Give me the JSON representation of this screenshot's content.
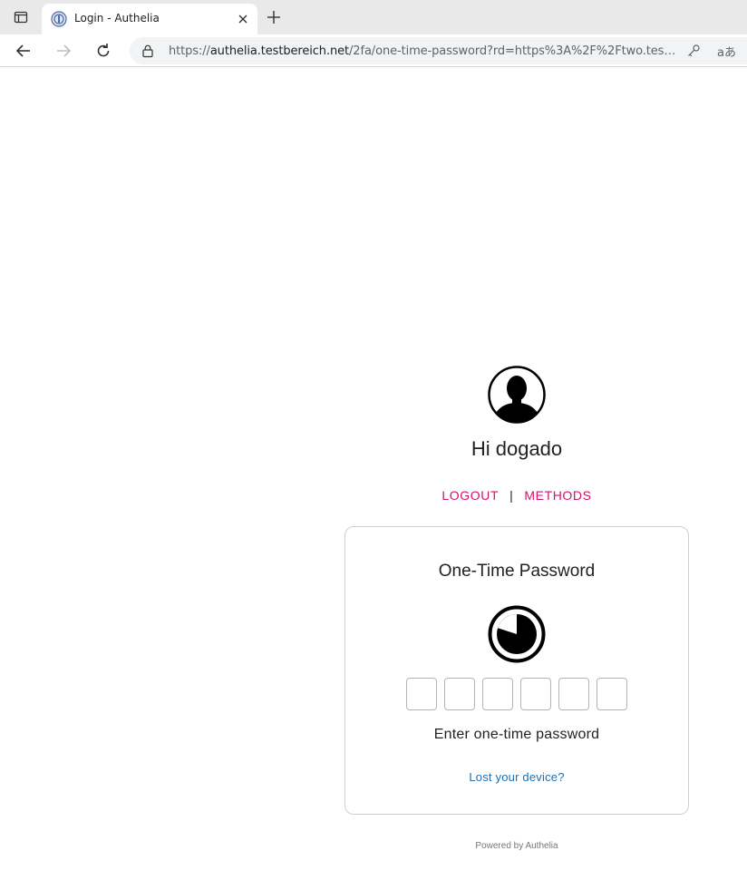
{
  "browser": {
    "tab_title": "Login - Authelia",
    "url_scheme": "https://",
    "url_domain": "authelia.testbereich.net",
    "url_path": "/2fa/one-time-password?rd=https%3A%2F%2Ftwo.testbe..."
  },
  "icons": {
    "tab_actions": "tab-actions-icon",
    "favicon": "authelia-favicon",
    "close": "close-icon",
    "new_tab": "plus-icon",
    "back": "arrow-left-icon",
    "forward": "arrow-right-icon",
    "reload": "reload-icon",
    "lock": "lock-icon",
    "key": "key-icon",
    "translate": "translate-icon",
    "avatar": "user-avatar-icon",
    "timer": "timer-icon"
  },
  "header": {
    "greeting": "Hi dogado",
    "logout_label": "LOGOUT",
    "separator": "|",
    "methods_label": "METHODS"
  },
  "card": {
    "title": "One-Time Password",
    "otp_digits": [
      "",
      "",
      "",
      "",
      "",
      ""
    ],
    "hint": "Enter one-time password",
    "lost_device": "Lost your device?"
  },
  "footer": {
    "powered_by": "Powered by Authelia"
  },
  "colors": {
    "accent": "#d3136b",
    "link": "#1f6fb2"
  }
}
